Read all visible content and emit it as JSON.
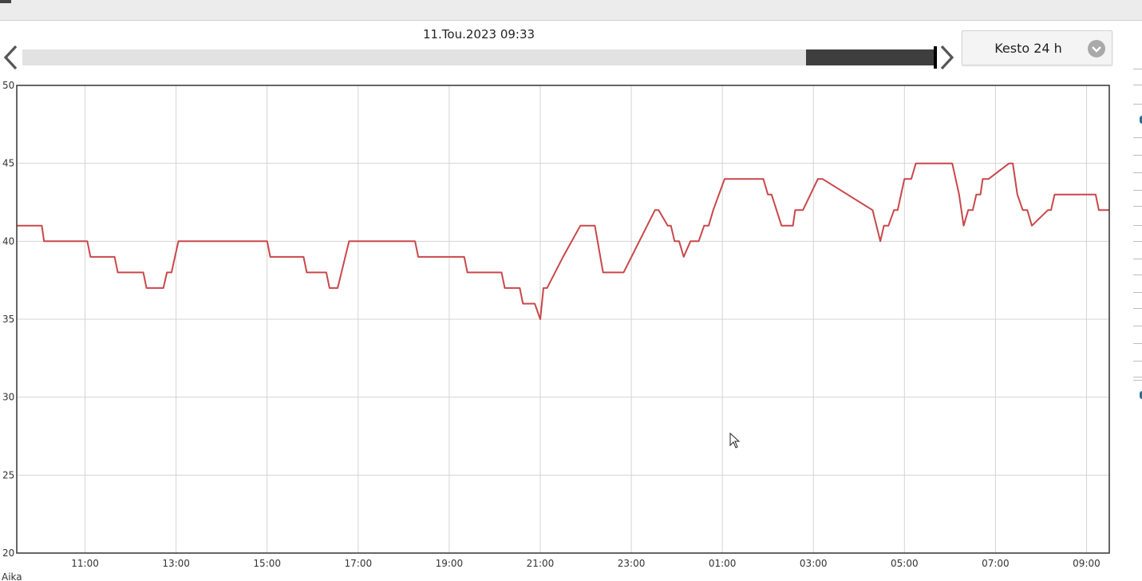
{
  "header": {
    "date_label": "11.Tou.2023 09:33",
    "duration_label": "Kesto 24 h"
  },
  "timeline": {
    "window_start_fraction": 0.858,
    "window_end_fraction": 1.0
  },
  "icons": {
    "prev": "chevron-left-icon",
    "next": "chevron-right-icon",
    "dropdown": "chevron-down-icon",
    "cursor": "mouse-cursor-icon"
  },
  "colors": {
    "series": "#c9474b",
    "grid": "#d4d4d4",
    "timeline_window": "#3e3e3e"
  },
  "chart_data": {
    "type": "line",
    "title": "",
    "xlabel": "Aika",
    "ylabel": "",
    "ylim": [
      20,
      50
    ],
    "yticks": [
      20,
      25,
      30,
      35,
      40,
      45,
      50
    ],
    "xlim_hours": [
      9.5,
      33.5
    ],
    "xtick_hours": [
      11,
      13,
      15,
      17,
      19,
      21,
      23,
      25,
      27,
      29,
      31,
      33
    ],
    "xtick_labels": [
      "11:00",
      "13:00",
      "15:00",
      "17:00",
      "19:00",
      "21:00",
      "23:00",
      "01:00",
      "03:00",
      "05:00",
      "07:00",
      "09:00"
    ],
    "grid": true,
    "series": [
      {
        "name": "",
        "x": [
          9.5,
          10.05,
          10.1,
          11.05,
          11.12,
          11.65,
          11.72,
          12.28,
          12.35,
          12.72,
          12.8,
          12.9,
          13.05,
          15.0,
          15.07,
          15.8,
          15.87,
          16.3,
          16.37,
          16.55,
          16.8,
          18.25,
          18.32,
          19.33,
          19.4,
          20.15,
          20.22,
          20.55,
          20.62,
          20.88,
          21.0,
          21.07,
          21.15,
          21.5,
          21.88,
          22.2,
          22.38,
          22.83,
          23.52,
          23.6,
          23.8,
          23.87,
          23.95,
          24.05,
          24.15,
          24.3,
          24.48,
          24.6,
          24.7,
          24.8,
          25.05,
          25.9,
          26.0,
          26.08,
          26.3,
          26.55,
          26.6,
          26.77,
          27.1,
          27.2,
          28.3,
          28.47,
          28.55,
          28.65,
          28.77,
          28.85,
          29.0,
          29.15,
          29.25,
          29.35,
          29.5,
          30.05,
          30.2,
          30.3,
          30.4,
          30.5,
          30.58,
          30.67,
          30.72,
          30.85,
          31.3,
          31.38,
          31.48,
          31.6,
          31.7,
          31.8,
          32.15,
          32.22,
          32.3,
          32.4,
          32.5,
          33.2,
          33.27,
          33.5
        ],
        "values": [
          41,
          41,
          40,
          40,
          39,
          39,
          38,
          38,
          37,
          37,
          38,
          38,
          40,
          40,
          39,
          39,
          38,
          38,
          37,
          37,
          40,
          40,
          39,
          39,
          38,
          38,
          37,
          37,
          36,
          36,
          35,
          37,
          37,
          39,
          41,
          41,
          38,
          38,
          42,
          42,
          41,
          41,
          40,
          40,
          39,
          40,
          40,
          41,
          41,
          42,
          44,
          44,
          43,
          43,
          41,
          41,
          42,
          42,
          44,
          44,
          42,
          40,
          41,
          41,
          42,
          42,
          44,
          44,
          45,
          45,
          45,
          45,
          43,
          41,
          42,
          42,
          43,
          43,
          44,
          44,
          45,
          45,
          43,
          42,
          42,
          41,
          42,
          42,
          43,
          43,
          43,
          43,
          42,
          42
        ]
      }
    ]
  }
}
